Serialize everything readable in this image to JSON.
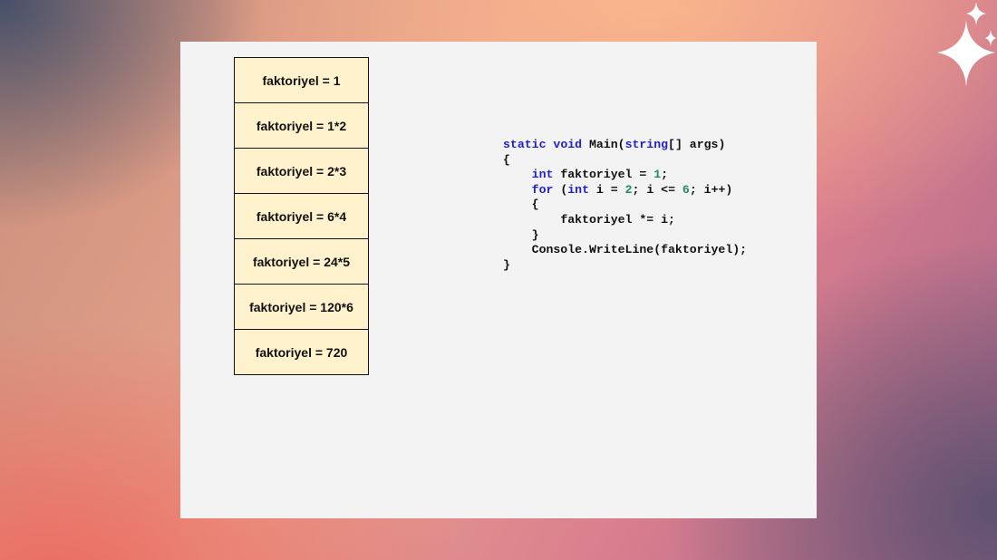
{
  "stack": {
    "items": [
      "faktoriyel = 1",
      "faktoriyel = 1*2",
      "faktoriyel = 2*3",
      "faktoriyel = 6*4",
      "faktoriyel = 24*5",
      "faktoriyel = 120*6",
      "faktoriyel = 720"
    ]
  },
  "code": {
    "l1_kw1": "static",
    "l1_kw2": "void",
    "l1_name": "Main(",
    "l1_type": "string",
    "l1_rest": "[] args)",
    "l2": "{",
    "l3_kw": "int",
    "l3_mid": "faktoriyel = ",
    "l3_num": "1",
    "l3_end": ";",
    "l4_kw1": "for",
    "l4_a": "(",
    "l4_kw2": "int",
    "l4_b": "i = ",
    "l4_num1": "2",
    "l4_c": "; i <= ",
    "l4_num2": "6",
    "l4_d": "; i++)",
    "l5": "{",
    "l6": "faktoriyel *= i;",
    "l7": "}",
    "l8": "Console.WriteLine(faktoriyel);",
    "l9": "}"
  },
  "colors": {
    "keyword": "#1f22c8",
    "number": "#1b8a6d",
    "cell_fill": "#fff2cc",
    "slide_bg": "#f3f3f3"
  },
  "icons": [
    "sparkle-icon"
  ]
}
